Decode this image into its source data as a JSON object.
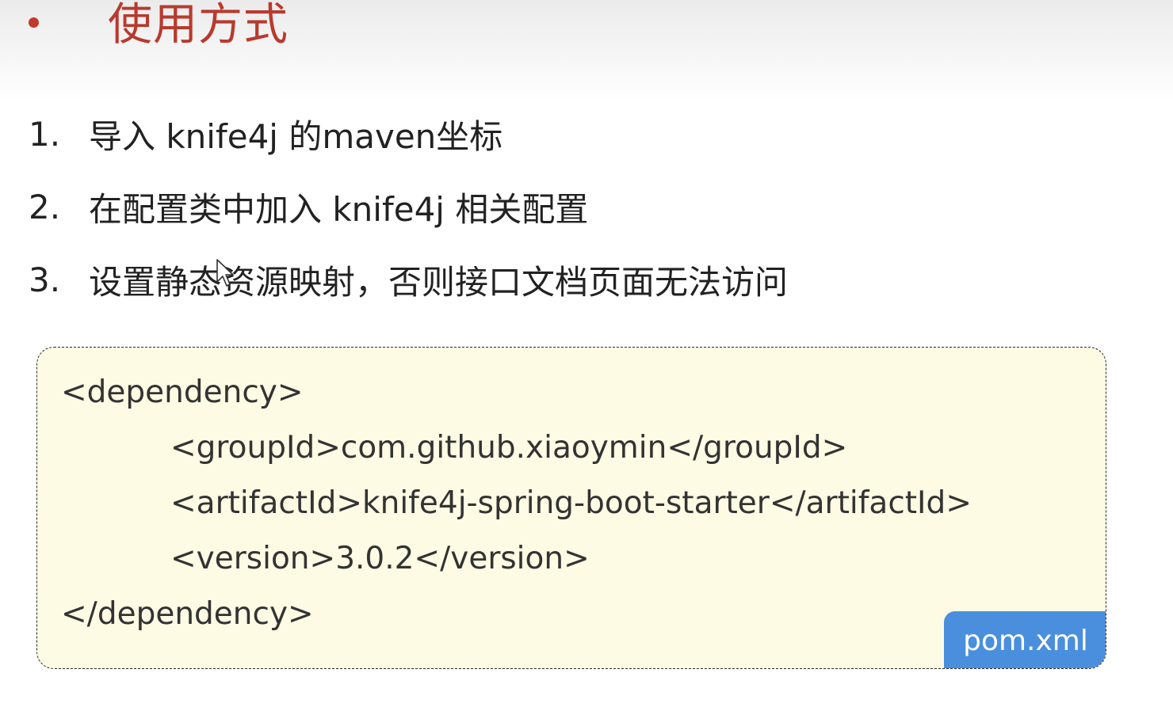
{
  "slide": {
    "title": "使用方式"
  },
  "steps": [
    {
      "number": "1.",
      "text": "导入 knife4j 的maven坐标"
    },
    {
      "number": "2.",
      "text": "在配置类中加入 knife4j 相关配置"
    },
    {
      "number": "3.",
      "text": "设置静态资源映射，否则接口文档页面无法访问"
    }
  ],
  "code": {
    "lines": [
      "<dependency>",
      "<groupId>com.github.xiaoymin</groupId>",
      "<artifactId>knife4j-spring-boot-starter</artifactId>",
      "<version>3.0.2</version>",
      "</dependency>"
    ],
    "file_label": "pom.xml"
  },
  "icons": {
    "title_bullet": "bullet-dot-icon",
    "cursor": "mouse-pointer-icon"
  },
  "colors": {
    "title": "#b83a2e",
    "code_background": "#fdfbe4",
    "file_label_background": "#4a8fdd"
  }
}
